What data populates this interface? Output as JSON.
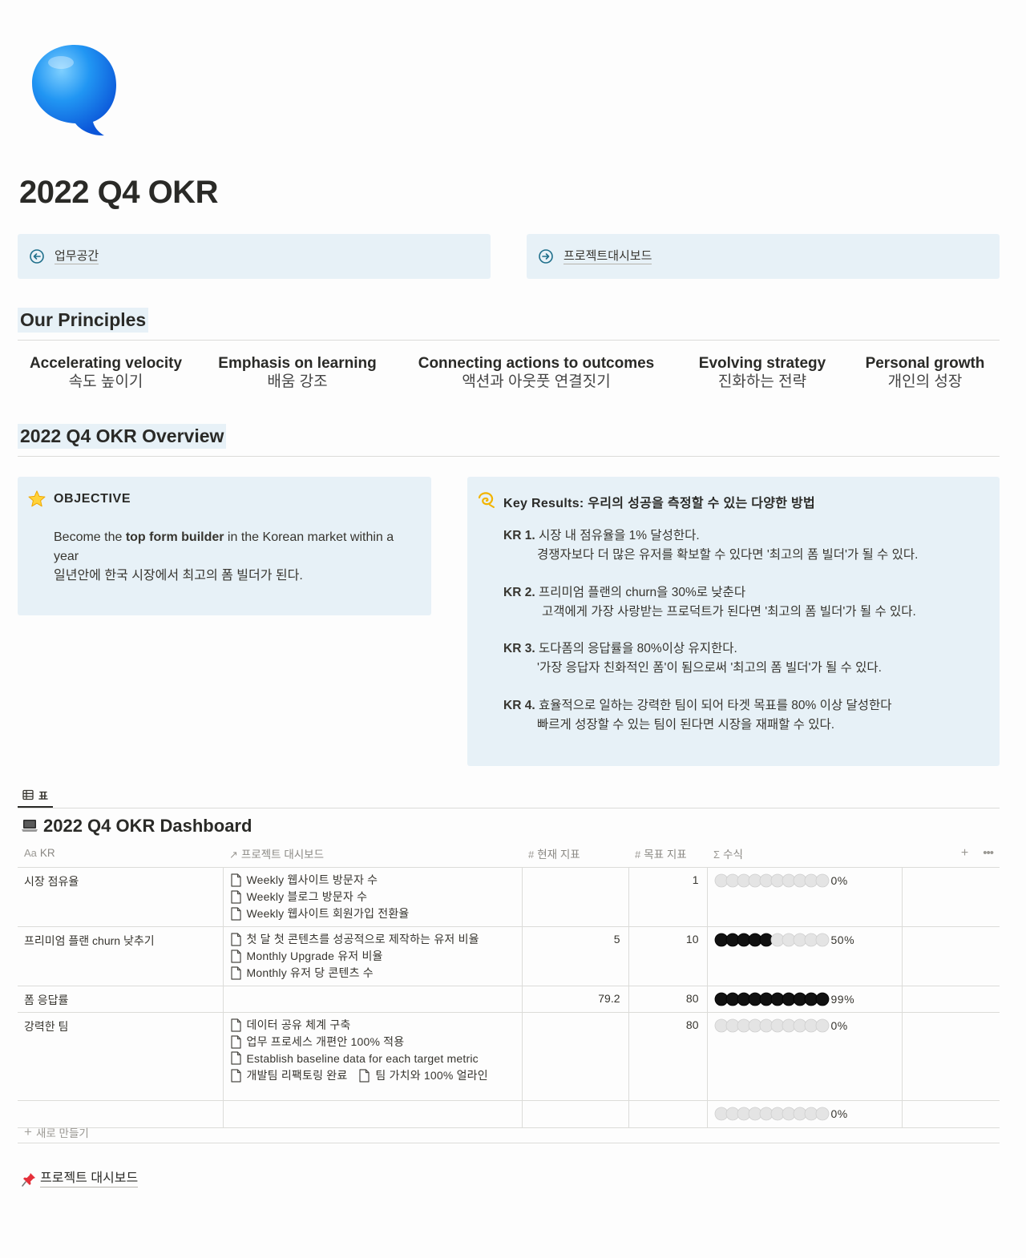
{
  "page": {
    "title": "2022 Q4 OKR"
  },
  "links": {
    "back_label": "업무공간",
    "forward_label": "프로젝트대시보드"
  },
  "principles": {
    "heading": "Our Principles",
    "items": [
      {
        "en": "Accelerating velocity",
        "ko": "속도 높이기"
      },
      {
        "en": "Emphasis on learning",
        "ko": "배움 강조"
      },
      {
        "en": "Connecting actions to outcomes",
        "ko": "액션과 아웃풋 연결짓기"
      },
      {
        "en": "Evolving strategy",
        "ko": "진화하는 전략"
      },
      {
        "en": "Personal growth",
        "ko": "개인의 성장"
      }
    ]
  },
  "overview": {
    "heading": "2022 Q4 OKR Overview",
    "objective": {
      "title": "OBJECTIVE",
      "text_pre": "Become the ",
      "text_bold": "top form builder",
      "text_post": " in the Korean market within a year",
      "text_ko": "일년안에 한국 시장에서 최고의 폼 빌더가 된다."
    },
    "key_results": {
      "title": "Key Results: 우리의 성공을 측정할 수 있는 다양한 방법",
      "items": [
        {
          "label": "KR 1.",
          "main": "시장 내 점유율을 1% 달성한다.",
          "sub": "경쟁자보다 더 많은 유저를 확보할 수 있다면 '최고의 폼 빌더'가 될 수 있다."
        },
        {
          "label": "KR 2.",
          "main": " 프리미엄 플랜의 churn을 30%로 낮춘다",
          "sub": " 고객에게 가장 사랑받는 프로덕트가 된다면 '최고의 폼 빌더'가 될 수 있다."
        },
        {
          "label": "KR 3.",
          "main": "도다폼의 응답률을 80%이상 유지한다.",
          "sub": "'가장 응답자 친화적인 폼'이 됨으로써 '최고의 폼 빌더'가 될 수 있다."
        },
        {
          "label": "KR 4.",
          "main": "효율적으로 일하는 강력한 팀이 되어 타겟 목표를 80% 이상 달성한다",
          "sub": "빠르게 성장할 수 있는 팀이 된다면 시장을 재패할 수 있다."
        }
      ]
    }
  },
  "database": {
    "view_tab": "표",
    "title": "2022 Q4 OKR Dashboard",
    "columns": {
      "kr": "KR",
      "kr_icon": "Aa",
      "project": "프로젝트 대시보드",
      "current": "현재 지표",
      "target": "목표 지표",
      "formula": "수식"
    },
    "rows": [
      {
        "kr": "시장 점유율",
        "projects": [
          "Weekly 웹사이트 방문자 수",
          "Weekly 블로그 방문자 수",
          "Weekly 웹사이트 회원가입 전환율"
        ],
        "current": "",
        "target": "1",
        "progress": 0,
        "pct": "0%"
      },
      {
        "kr": "프리미엄 플랜 churn 낮추기",
        "projects": [
          "첫 달 첫 콘텐츠를 성공적으로 제작하는 유저 비율",
          "Monthly Upgrade 유저 비율",
          "Monthly 유저 당 콘텐츠 수"
        ],
        "current": "5",
        "target": "10",
        "progress": 0.5,
        "pct": "50%"
      },
      {
        "kr": "폼 응답률",
        "projects": [],
        "current": "79.2",
        "target": "80",
        "progress": 0.99,
        "pct": "99%"
      },
      {
        "kr": "강력한 팀",
        "projects": [
          "데이터 공유 체계 구축",
          "업무 프로세스 개편안 100% 적용",
          "Establish baseline data for each target metric",
          "개발팀 리팩토링 완료",
          "팀 가치와 100% 얼라인"
        ],
        "current": "",
        "target": "80",
        "progress": 0,
        "pct": "0%"
      },
      {
        "kr": "",
        "projects": [],
        "current": "",
        "target": "",
        "progress": 0,
        "pct": "0%"
      }
    ],
    "new_label": "새로 만들기"
  },
  "footer_link": {
    "label": "프로젝트 대시보드"
  },
  "icons": {
    "page_icon": "speech-bubble-icon",
    "objective_icon": "star-icon",
    "kr_icon": "dizzy-icon",
    "dashboard_icon": "laptop-icon",
    "footer_icon": "pushpin-icon"
  },
  "colors": {
    "callout_bg": "#e7f1f7",
    "link_arrow": "#1f6f8b",
    "progress_filled": "#111111",
    "progress_empty": "#e4e4e4"
  }
}
